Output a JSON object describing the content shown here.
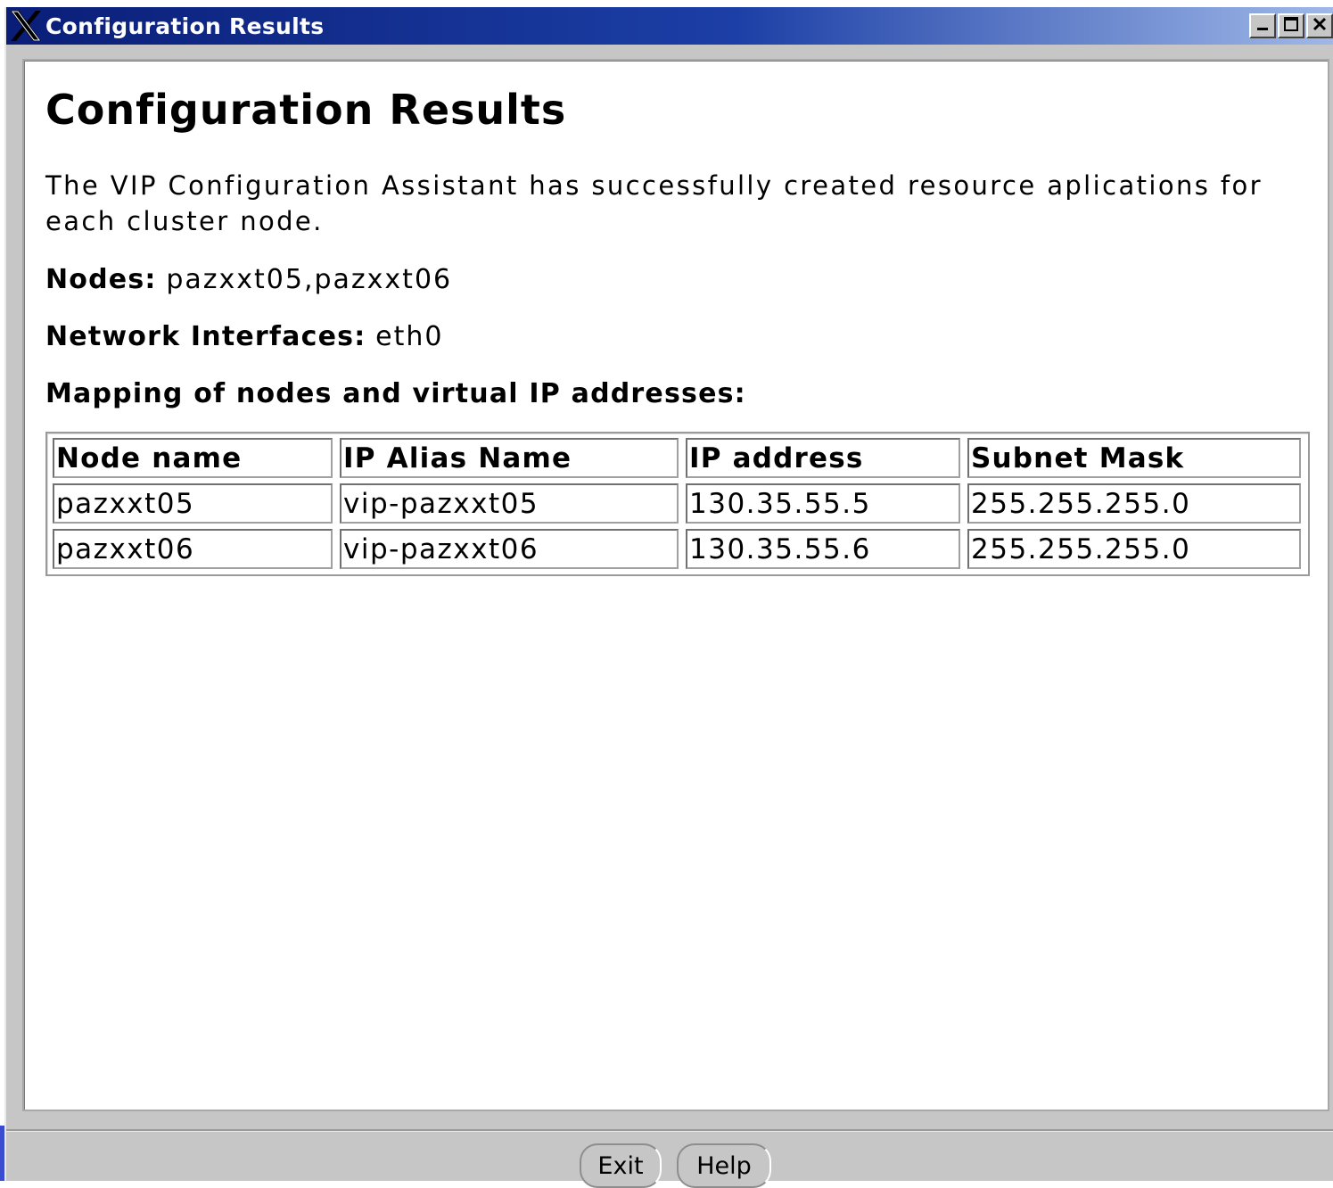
{
  "window": {
    "title": "Configuration Results"
  },
  "content": {
    "heading": "Configuration Results",
    "description": "The VIP Configuration Assistant has successfully created resource aplications for each cluster node.",
    "nodes_label": "Nodes:",
    "nodes_value": "pazxxt05,pazxxt06",
    "interfaces_label": "Network Interfaces:",
    "interfaces_value": "eth0",
    "mapping_label": "Mapping of nodes and virtual IP addresses:"
  },
  "table": {
    "headers": [
      "Node name",
      "IP Alias Name",
      "IP address",
      "Subnet Mask"
    ],
    "rows": [
      [
        "pazxxt05",
        "vip-pazxxt05",
        "130.35.55.5",
        "255.255.255.0"
      ],
      [
        "pazxxt06",
        "vip-pazxxt06",
        "130.35.55.6",
        "255.255.255.0"
      ]
    ]
  },
  "buttons": {
    "exit": "Exit",
    "help": "Help"
  },
  "icons": {
    "window_logo": "x-logo-icon",
    "minimize": "minimize-icon",
    "maximize": "maximize-icon",
    "close": "close-icon"
  },
  "colors": {
    "titlebar_start": "#0a1e78",
    "titlebar_end": "#9fb8e8",
    "chrome": "#c6c6c6",
    "panel": "#ffffff"
  }
}
